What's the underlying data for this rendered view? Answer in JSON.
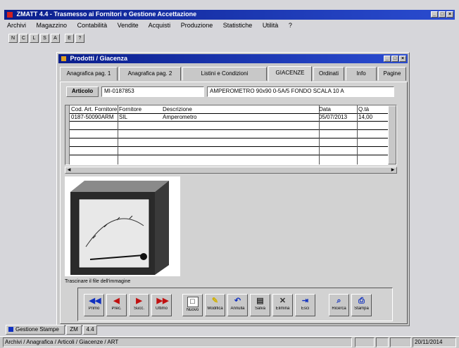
{
  "app": {
    "title": "ZMATT 4.4 - Trasmesso ai Fornitori e Gestione Accettazione",
    "window_buttons": [
      "_",
      "□",
      "×"
    ]
  },
  "menu": [
    "Archivi",
    "Magazzino",
    "Contabilità",
    "Vendite",
    "Acquisti",
    "Produzione",
    "Statistiche",
    "Utilità",
    "?"
  ],
  "toolbar": [
    "N",
    "C",
    "L",
    "S",
    "A",
    "E",
    "?"
  ],
  "child": {
    "title": "Prodotti / Giacenza",
    "tabs": [
      "Anagrafica pag. 1",
      "Anagrafica pag. 2",
      "Listini e Condizioni",
      "GIACENZE",
      "Ordinati",
      "Info",
      "Pagine"
    ],
    "active_tab": 3,
    "code_label": "Articolo",
    "code_value": "MI-0187853",
    "description_value": "AMPEROMETRO 90x90 0-5A/5 FONDO SCALA 10 A",
    "table": {
      "headers": [
        "Cod. Art. Fornitore",
        "Fornitore",
        "Descrizione",
        "Data",
        "Q.tà"
      ],
      "rows": [
        [
          "0187-50090ARM",
          "SIL",
          "Amperometro",
          "05/07/2013",
          "14,00"
        ]
      ]
    },
    "image_caption": "Trascinare il file dell'immagine",
    "nav_buttons": [
      {
        "label": "Primo",
        "icon": "◀◀"
      },
      {
        "label": "Prec.",
        "icon": "◀"
      },
      {
        "label": "Succ.",
        "icon": "▶"
      },
      {
        "label": "Ultimo",
        "icon": "▶▶"
      },
      {
        "label": "Nuovo",
        "icon": "□"
      },
      {
        "label": "Modifica",
        "icon": "✎"
      },
      {
        "label": "Annulla",
        "icon": "↶"
      },
      {
        "label": "Salva",
        "icon": "▤"
      },
      {
        "label": "Elimina",
        "icon": "✕"
      },
      {
        "label": "Esci",
        "icon": "⇥"
      },
      {
        "label": "Ricerca",
        "icon": "⌕"
      },
      {
        "label": "Stampa",
        "icon": "⎙"
      }
    ],
    "nav_colors": [
      "#1030c0",
      "#c01010",
      "#c01010",
      "#c01010",
      "#ffffff",
      "#d0b000",
      "#1030c0",
      "#303030",
      "#303030",
      "#1030c0",
      "#1030c0",
      "#1030c0"
    ]
  },
  "taskbar": {
    "items": [
      "Gestione Stampe",
      "ZM",
      "4.4"
    ]
  },
  "statusbar": {
    "path": "Archivi / Anagrafica / Articoli / Giacenze / ART",
    "panels": [
      "",
      "",
      "",
      "20/11/2014"
    ]
  }
}
